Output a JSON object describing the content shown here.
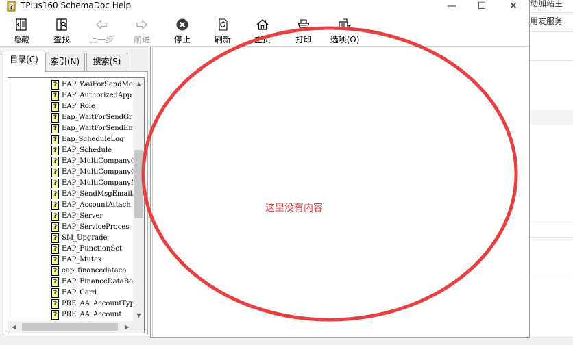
{
  "window": {
    "title": "TPlus160 SchemaDoc Help",
    "controls": {
      "minimize": "—",
      "maximize": "☐",
      "close": "✕"
    }
  },
  "toolbar": {
    "hide": "隐藏",
    "find": "查找",
    "back": "上一步",
    "forward": "前进",
    "stop": "停止",
    "refresh": "刷新",
    "home": "主页",
    "print": "打印",
    "options": "选项(O)"
  },
  "tabs": {
    "contents": "目录(C)",
    "index": "索引(N)",
    "search": "搜索(S)",
    "active": "contents"
  },
  "tree": {
    "icon_glyph": "?",
    "items": [
      "EAP_WaiForSendMes",
      "EAP_AuthorizedApp",
      "EAP_Role",
      "Eap_WaitForSendGr",
      "Eap_WaitForSendEm",
      "Eap_ScheduleLog",
      "EAP_Schedule",
      "EAP_MultiCompanyC",
      "EAP_MultiCompanyG",
      "EAP_MultiCompanyM",
      "EAP_SendMsgEmailA",
      "EAP_AccountAttach",
      "EAP_Server",
      "EAP_ServiceProces",
      "SM_Upgrade",
      "EAP_FunctionSet",
      "EAP_Mutex",
      "eap_financedataco",
      "EAP_FinanceDataBo",
      "EAP_Card",
      "PRE_AA_AccountTyp",
      "PRE_AA_Account"
    ]
  },
  "content": {
    "empty_message": "这里没有内容"
  },
  "background_app": {
    "text_top": "动加站主",
    "text_service": "用友服务"
  },
  "colors": {
    "annotation_red": "#e84040",
    "selection": "#ffffff"
  }
}
